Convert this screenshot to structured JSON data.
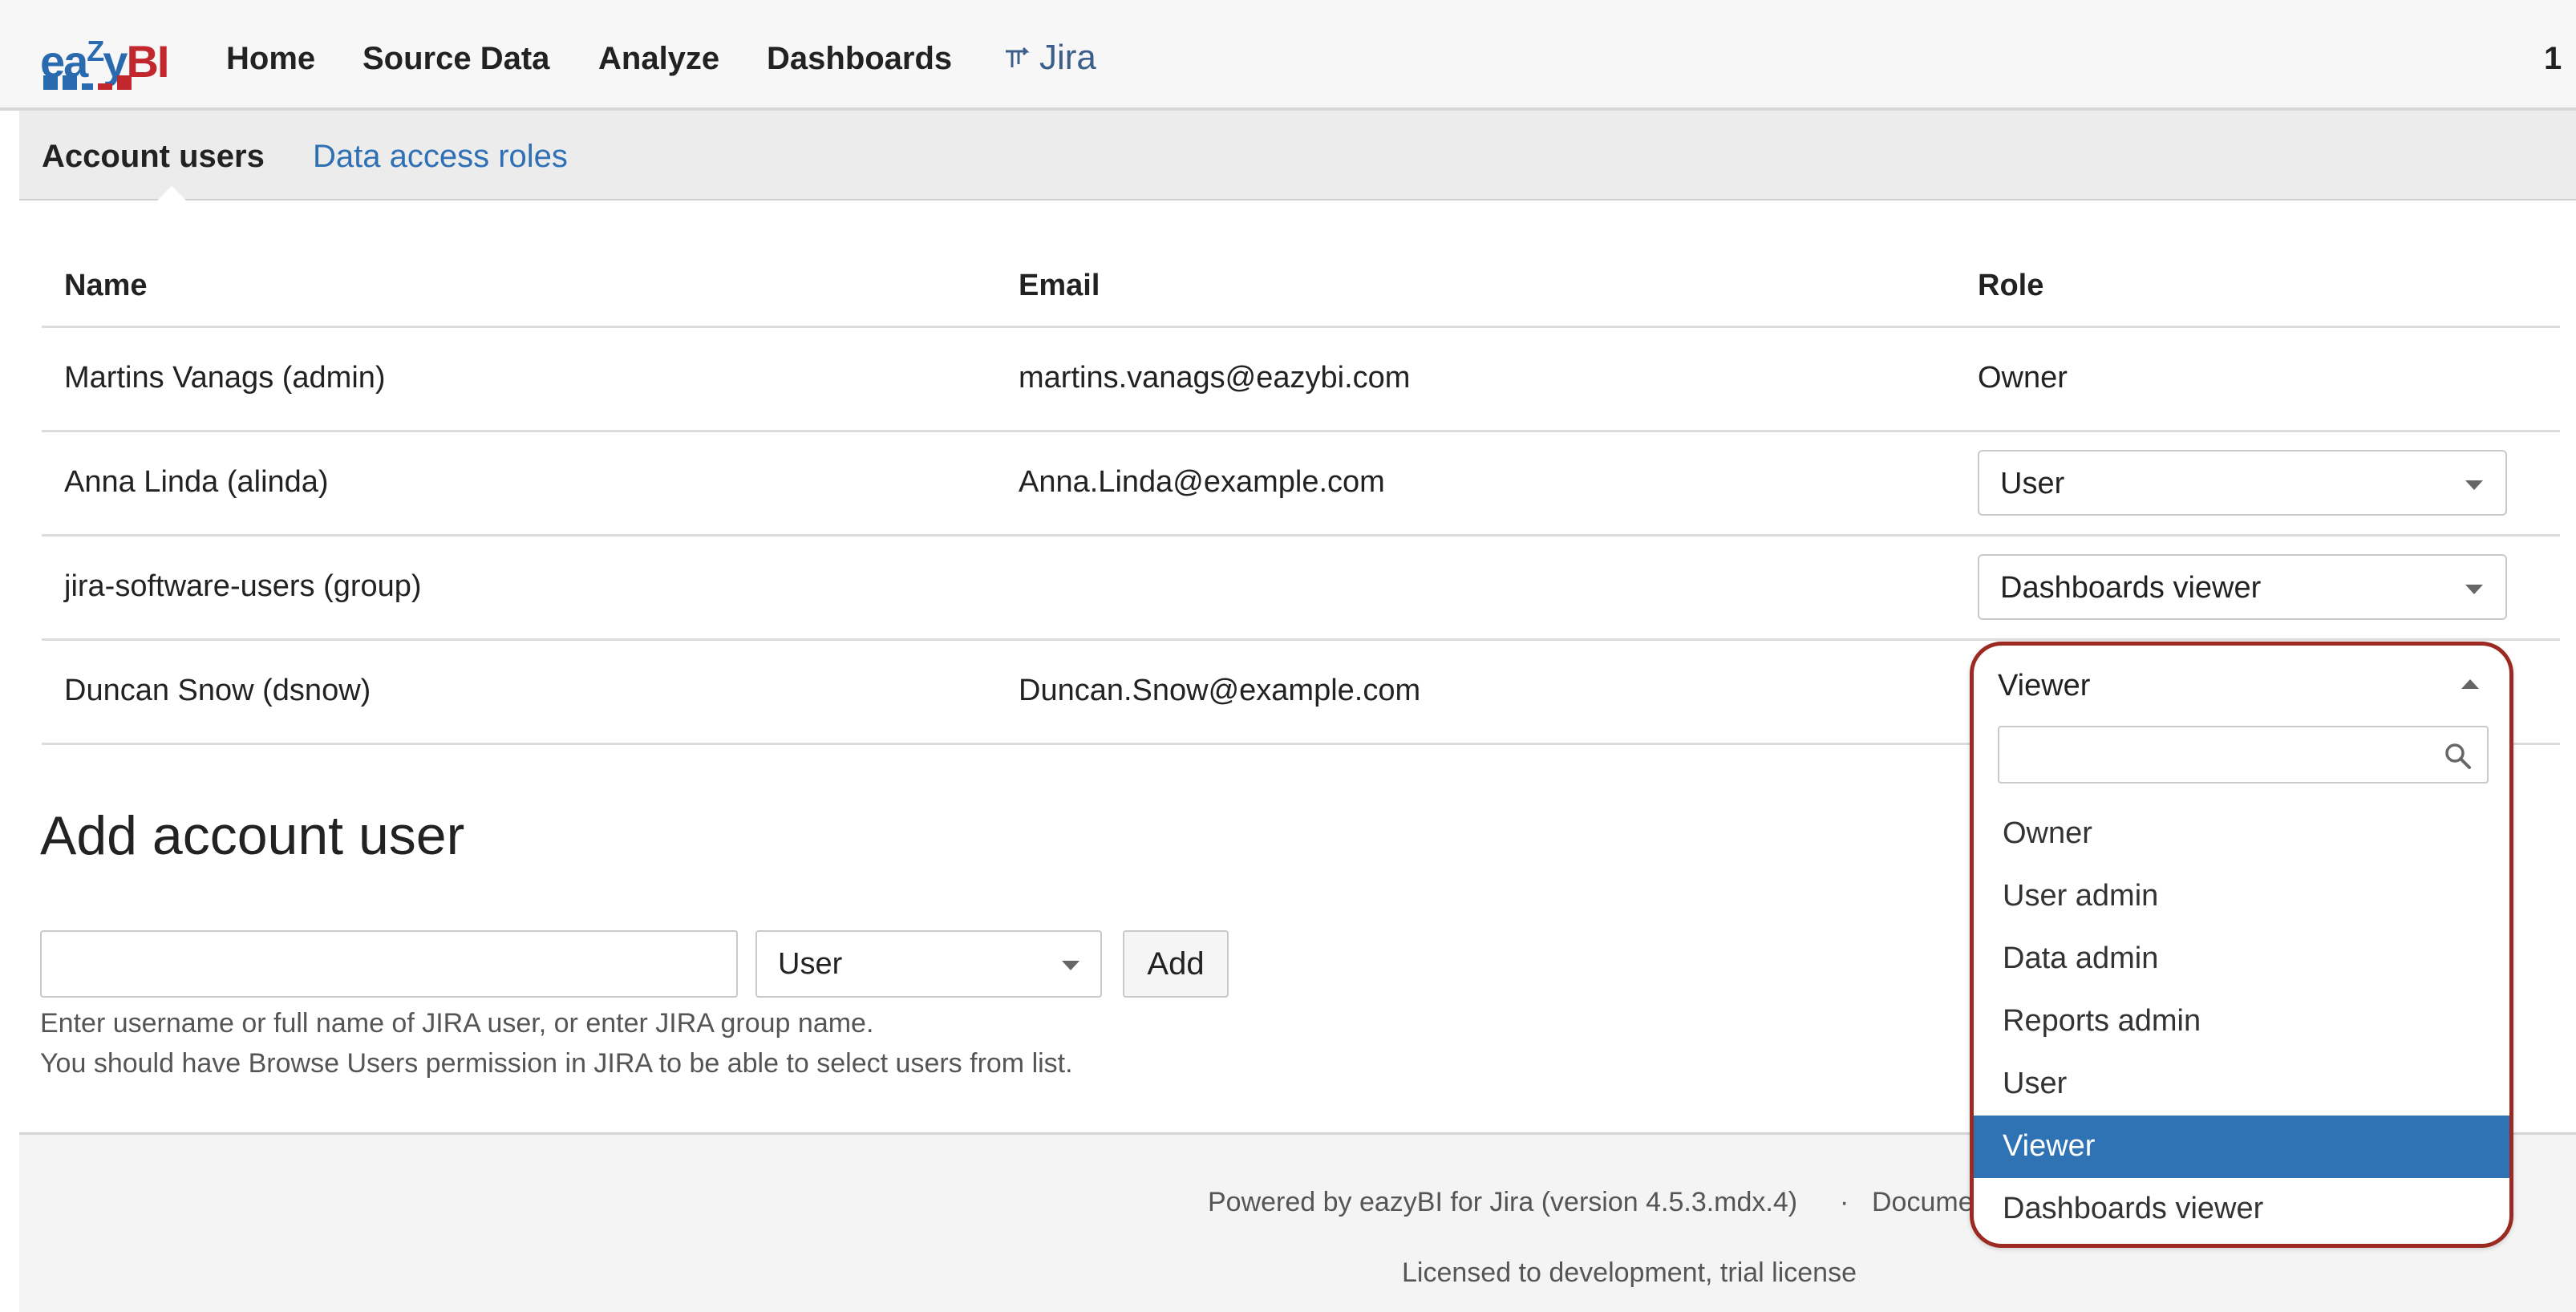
{
  "app": {
    "logo": {
      "part_blue": "ea",
      "part_z": "Z",
      "part_y": "y",
      "part_bi": "BI"
    },
    "nav": [
      "Home",
      "Source Data",
      "Analyze",
      "Dashboards"
    ],
    "jira_label": "Jira",
    "corner_text": "1"
  },
  "subnav": {
    "active_tab": "Account users",
    "other_tab": "Data access roles"
  },
  "table": {
    "headers": {
      "name": "Name",
      "email": "Email",
      "role": "Role"
    },
    "rows": [
      {
        "name": "Martins Vanags (admin)",
        "email": "martins.vanags@eazybi.com",
        "role": "Owner"
      },
      {
        "name": "Anna Linda (alinda)",
        "email": "Anna.Linda@example.com",
        "role": "User"
      },
      {
        "name": "jira-software-users (group)",
        "email": "",
        "role": "Dashboards viewer"
      },
      {
        "name": "Duncan Snow (dsnow)",
        "email": "Duncan.Snow@example.com",
        "role": "Viewer"
      }
    ]
  },
  "add_user": {
    "title": "Add account user",
    "input_value": "",
    "role_value": "User",
    "add_label": "Add",
    "help_line1": "Enter username or full name of JIRA user, or enter JIRA group name.",
    "help_line2": "You should have Browse Users permission in JIRA to be able to select users from list."
  },
  "footer": {
    "powered": "Powered by eazyBI for Jira (version 4.5.3.mdx.4)",
    "separator": "·",
    "docs": "Docume",
    "license": "Licensed to development, trial license"
  },
  "dropdown": {
    "current": "Viewer",
    "search_value": "",
    "options": [
      "Owner",
      "User admin",
      "Data admin",
      "Reports admin",
      "User",
      "Viewer",
      "Dashboards viewer"
    ],
    "selected": "Viewer"
  },
  "colors": {
    "link": "#2f6fb3",
    "highlight": "#2f73b5",
    "callout": "#9a2a22"
  }
}
